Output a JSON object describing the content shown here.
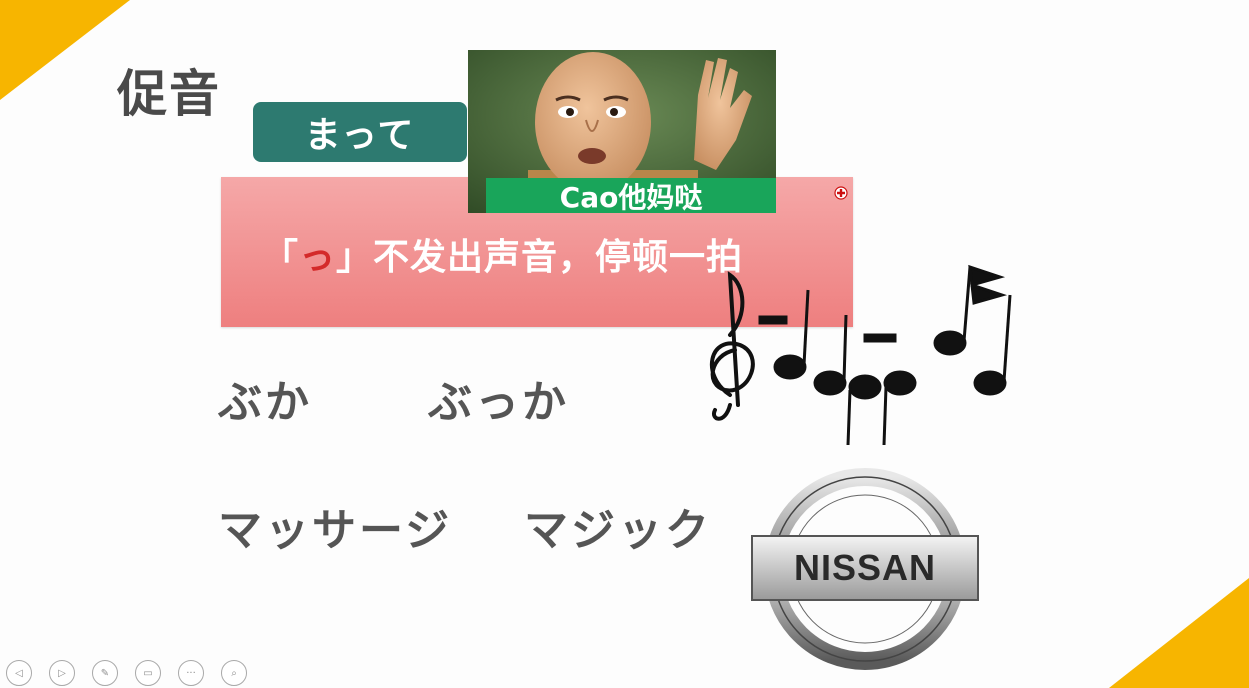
{
  "slide": {
    "title": "促音",
    "pill_label": "まって",
    "rule": {
      "open_bracket": "「",
      "highlight": "っ",
      "rest": "」不发出声音，停顿一拍"
    },
    "meme": {
      "caption": "Cao他妈哒"
    },
    "examples": {
      "row1_a": "ぶか",
      "row1_b": "ぶっか",
      "row2_a": "マッサージ",
      "row2_b": "マジック"
    },
    "logo_text": "NISSAN"
  },
  "colors": {
    "accent_yellow": "#f7b500",
    "pill_teal": "#2d7a70",
    "rule_pink": "#f08a8a",
    "caption_green": "#19a55a",
    "highlight_red": "#d42a2a"
  },
  "player_controls": [
    {
      "name": "prev-icon",
      "glyph": "◁"
    },
    {
      "name": "next-icon",
      "glyph": "▷"
    },
    {
      "name": "pen-icon",
      "glyph": "✎"
    },
    {
      "name": "slides-icon",
      "glyph": "▭"
    },
    {
      "name": "more-icon",
      "glyph": "···"
    },
    {
      "name": "zoom-icon",
      "glyph": "⌕"
    }
  ]
}
